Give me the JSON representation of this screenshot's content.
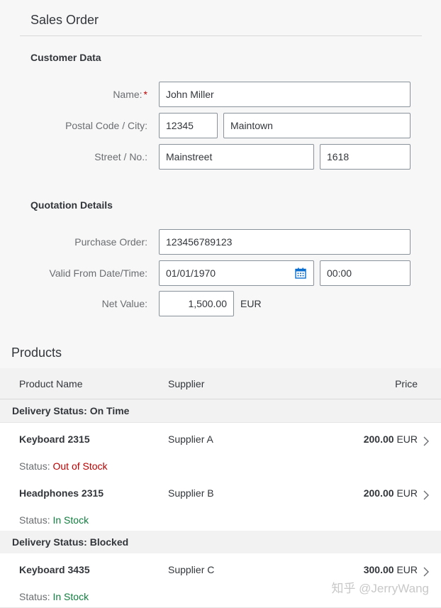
{
  "page": {
    "title": "Sales Order"
  },
  "customer": {
    "section_title": "Customer Data",
    "name_label": "Name:",
    "required_mark": "*",
    "name_value": "John Miller",
    "postal_label": "Postal Code / City:",
    "postal_value": "12345",
    "city_value": "Maintown",
    "street_label": "Street / No.:",
    "street_value": "Mainstreet",
    "number_value": "1618"
  },
  "quotation": {
    "section_title": "Quotation Details",
    "po_label": "Purchase Order:",
    "po_value": "123456789123",
    "valid_label": "Valid From Date/Time:",
    "date_value": "01/01/1970",
    "time_value": "00:00",
    "net_label": "Net Value:",
    "net_value": "1,500.00",
    "currency": "EUR",
    "calendar_icon": "calendar-icon"
  },
  "products": {
    "title": "Products",
    "columns": [
      "Product Name",
      "Supplier",
      "Price"
    ],
    "status_prefix": "Status:",
    "groups": [
      {
        "label": "Delivery Status: On Time",
        "items": [
          {
            "name": "Keyboard 2315",
            "supplier": "Supplier A",
            "price": "200.00",
            "currency": "EUR",
            "status": "Out of Stock"
          },
          {
            "name": "Headphones 2315",
            "supplier": "Supplier B",
            "price": "200.00",
            "currency": "EUR",
            "status": "In Stock"
          }
        ]
      },
      {
        "label": "Delivery Status: Blocked",
        "items": [
          {
            "name": "Keyboard 3435",
            "supplier": "Supplier C",
            "price": "300.00",
            "currency": "EUR",
            "status": "In Stock"
          }
        ]
      }
    ]
  },
  "colors": {
    "negative": "#bb0000",
    "positive": "#107e3e",
    "accent": "#0a6ed1"
  },
  "watermark": "知乎 @JerryWang"
}
